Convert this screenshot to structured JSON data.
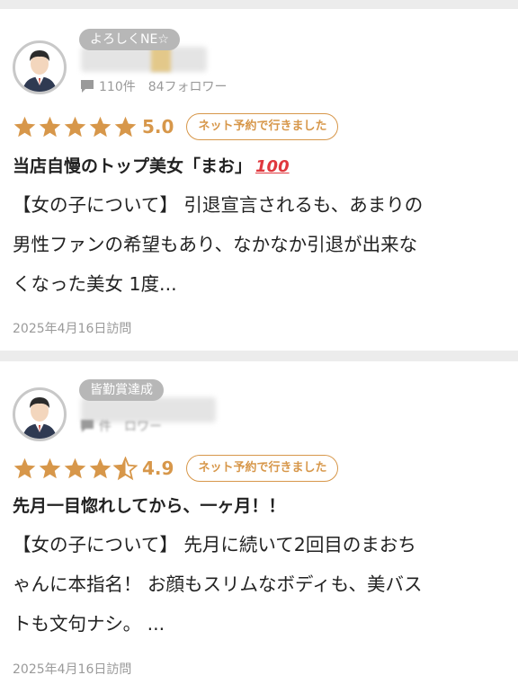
{
  "reviews": [
    {
      "badge": "よろしくNE☆",
      "reviews_count": "110件",
      "followers": "84フォロワー",
      "score": "5.0",
      "stars": 5.0,
      "reserve_label": "ネット予約で行きました",
      "title": "当店自慢のトップ美女「まお」",
      "title_emoji": "100",
      "body_lines": [
        "【女の子について】 引退宣言されるも、あまりの",
        "男性ファンの希望もあり、なかなか引退が出来な",
        "くなった美女 1度..."
      ],
      "date": "2025年4月16日訪問"
    },
    {
      "badge": "皆勤賞達成",
      "reviews_count": "件",
      "followers": "ロワー",
      "score": "4.9",
      "stars": 4.5,
      "reserve_label": "ネット予約で行きました",
      "title": "先月一目惚れしてから、一ヶ月！！",
      "body_lines": [
        "【女の子について】 先月に続いて2回目のまおち",
        "ゃんに本指名！ お顔もスリムなボディも、美バス",
        "トも文句ナシ。 ..."
      ],
      "date": "2025年4月16日訪問"
    }
  ],
  "colors": {
    "accent": "#d7974a",
    "badge_bg": "#b7b7b7",
    "muted_text": "#9a9a9a"
  }
}
